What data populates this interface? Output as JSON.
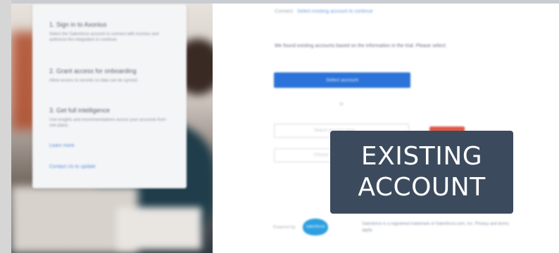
{
  "sidebar": {
    "steps": [
      {
        "title": "1. Sign in to Axonius",
        "description": "Select the Salesforce account to connect with Axonius and authorize the integration to continue."
      },
      {
        "title": "2. Grant access for onboarding",
        "description": "Allow access to records so data can be synced."
      },
      {
        "title": "3. Get full intelligence",
        "description": "Use insights and recommendations across your accounts from one place."
      }
    ],
    "links": [
      "Learn more",
      "Contact Us to update"
    ]
  },
  "main": {
    "breadcrumb": {
      "prefix": "Connect",
      "link": "Select existing account to continue"
    },
    "instructions": "We found existing accounts based on the information in the trial. Please select:",
    "primary_button": "Select account",
    "separator": "or",
    "fields": [
      {
        "placeholder": "Search account name"
      },
      {
        "placeholder": "Choose"
      }
    ]
  },
  "footer": {
    "label": "Powered by",
    "logo_text": "salesforce",
    "links": "Salesforce is a registered trademark of Salesforce.com, Inc. Privacy and terms apply."
  },
  "overlay": {
    "line1": "EXISTING",
    "line2": "ACCOUNT"
  },
  "colors": {
    "primary": "#2b73d8",
    "caption_bg": "#3c4a5d",
    "danger": "#e05745"
  }
}
